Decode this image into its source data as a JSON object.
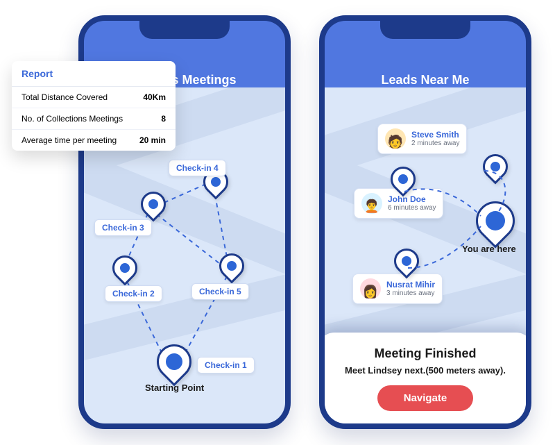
{
  "left": {
    "title": "Today's Meetings",
    "start_caption": "Starting Point",
    "checkins": {
      "c1": "Check-in 1",
      "c2": "Check-in 2",
      "c3": "Check-in 3",
      "c4": "Check-in 4",
      "c5": "Check-in 5"
    }
  },
  "report": {
    "title": "Report",
    "rows": [
      {
        "label": "Total Distance Covered",
        "value": "40Km"
      },
      {
        "label": "No. of Collections Meetings",
        "value": "8"
      },
      {
        "label": "Average time per meeting",
        "value": "20 min"
      }
    ]
  },
  "right": {
    "title": "Leads Near Me",
    "you_are_here": "You are here",
    "leads": [
      {
        "name": "Steve Smith",
        "time": "2 minutes away",
        "bg": "#ffe6b3"
      },
      {
        "name": "John Doe",
        "time": "6 minutes away",
        "bg": "#d9f2ff"
      },
      {
        "name": "Nusrat Mihir",
        "time": "3 minutes away",
        "bg": "#ffd9e0"
      }
    ]
  },
  "sheet": {
    "heading": "Meeting Finished",
    "subline": "Meet Lindsey next.(500 meters away).",
    "button": "Navigate"
  }
}
